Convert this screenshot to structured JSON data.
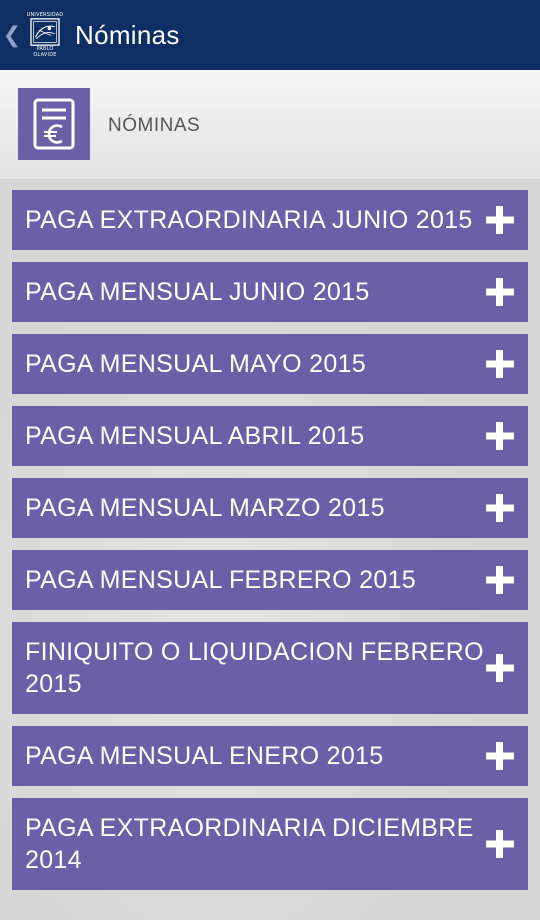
{
  "appbar": {
    "back_glyph": "❮",
    "title": "Nóminas",
    "logo": {
      "top_text": "UNIVERSIDAD",
      "bottom_text": "PABLO OLAVIDE"
    }
  },
  "header": {
    "icon": "payslip-euro-icon",
    "label": "NÓMINAS"
  },
  "colors": {
    "appbar": "#0d2f63",
    "item_background": "#6b5fa8",
    "item_text": "#ffffff",
    "page_background": "#d6d6d6"
  },
  "items": [
    {
      "label": "PAGA EXTRAORDINARIA JUNIO 2015",
      "icon": "plus-icon"
    },
    {
      "label": "PAGA MENSUAL JUNIO 2015",
      "icon": "plus-icon"
    },
    {
      "label": "PAGA MENSUAL MAYO 2015",
      "icon": "plus-icon"
    },
    {
      "label": "PAGA MENSUAL ABRIL 2015",
      "icon": "plus-icon"
    },
    {
      "label": "PAGA MENSUAL MARZO 2015",
      "icon": "plus-icon"
    },
    {
      "label": "PAGA MENSUAL FEBRERO 2015",
      "icon": "plus-icon"
    },
    {
      "label": "FINIQUITO O LIQUIDACION FEBRERO 2015",
      "icon": "plus-icon"
    },
    {
      "label": "PAGA MENSUAL ENERO 2015",
      "icon": "plus-icon"
    },
    {
      "label": "PAGA EXTRAORDINARIA DICIEMBRE 2014",
      "icon": "plus-icon"
    }
  ]
}
